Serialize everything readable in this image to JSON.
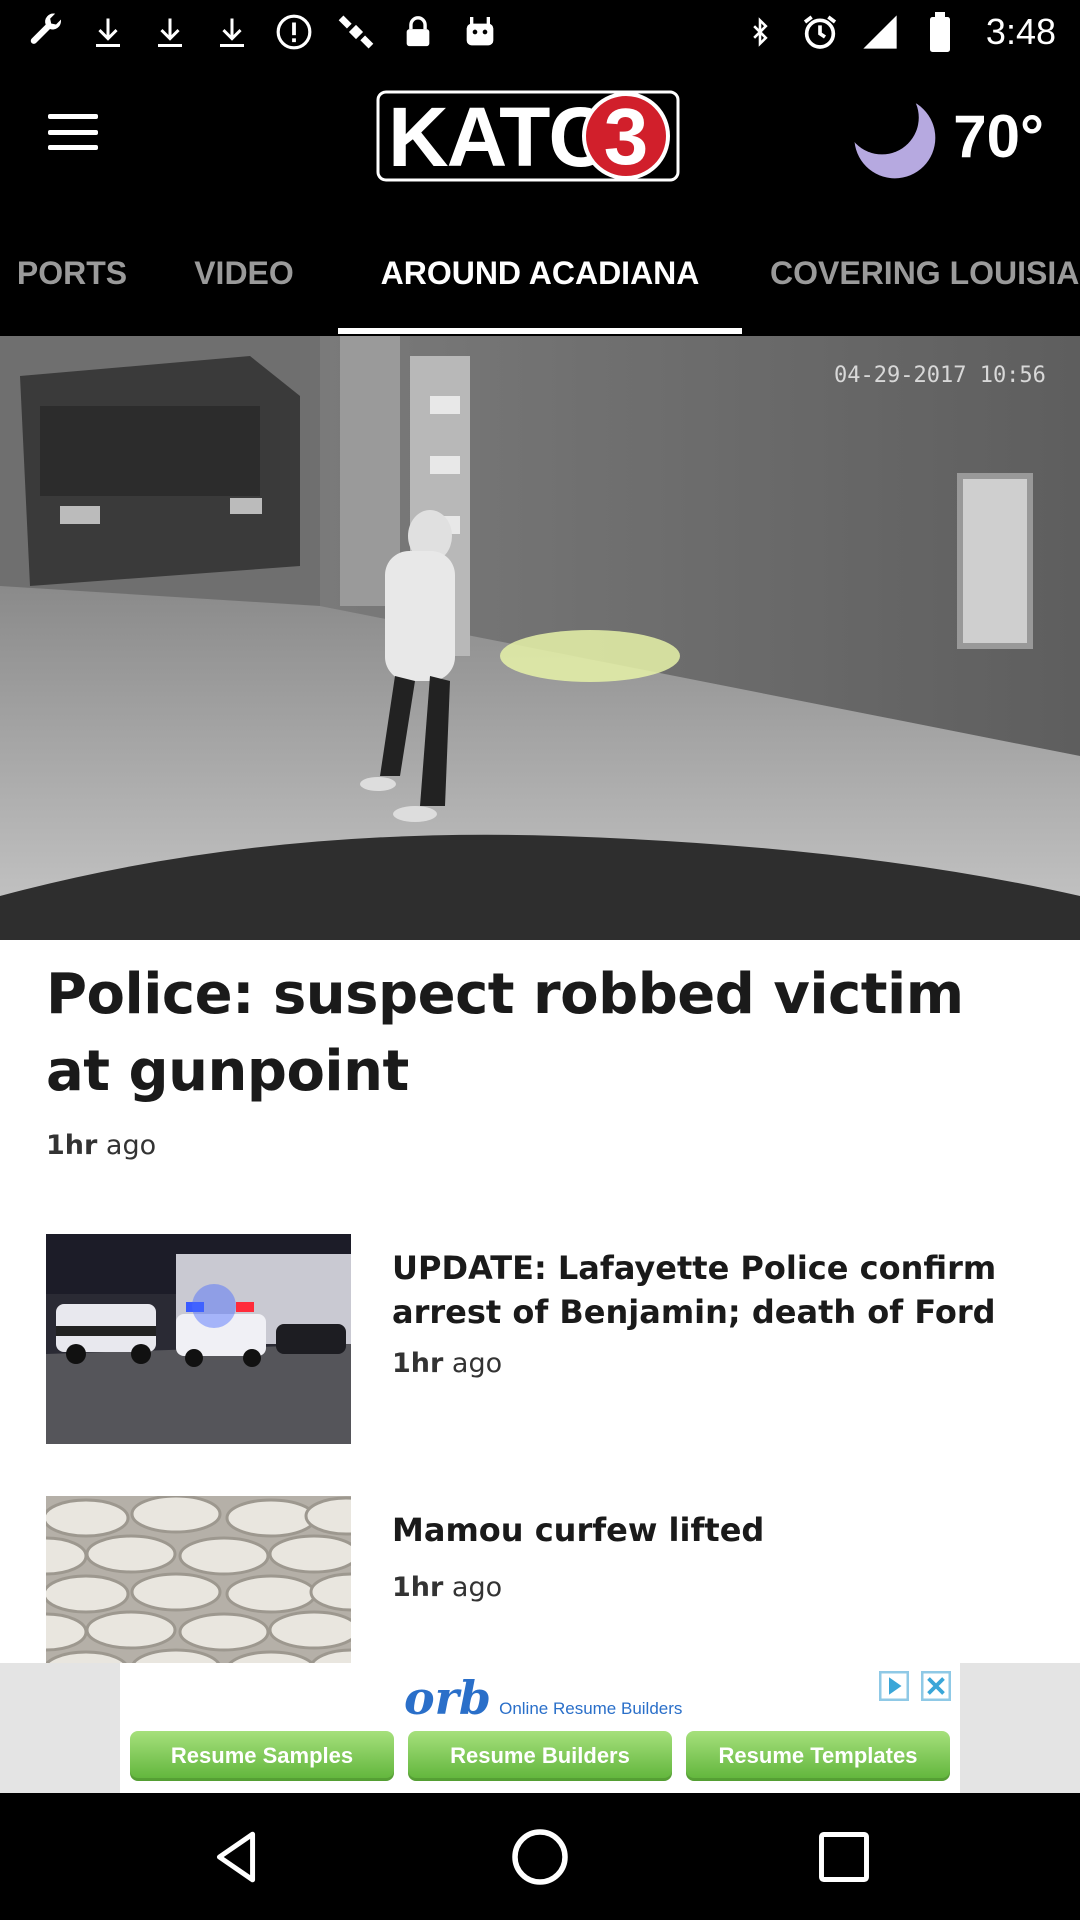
{
  "status_bar": {
    "time": "3:48",
    "left_icons": [
      "wrench-icon",
      "download-icon",
      "download-icon",
      "download-icon",
      "alert-icon",
      "satellite-icon",
      "lock-icon",
      "android-icon"
    ],
    "right_icons": [
      "bluetooth-icon",
      "alarm-icon",
      "signal-icon",
      "battery-icon"
    ]
  },
  "header": {
    "logo_text": "KATC",
    "logo_number": "3",
    "temperature": "70°",
    "weather_icon": "moon-icon"
  },
  "tabs": {
    "items": [
      {
        "label": "PORTS"
      },
      {
        "label": "VIDEO"
      },
      {
        "label": "AROUND ACADIANA"
      },
      {
        "label": "COVERING LOUISIA"
      }
    ],
    "active_index": 2
  },
  "hero": {
    "timestamp_overlay": "04-29-2017  10:56",
    "title": "Police: suspect robbed victim at gunpoint",
    "time_num": "1hr",
    "time_unit": "ago"
  },
  "stories": [
    {
      "title": "UPDATE: Lafayette Police confirm arrest of Benjamin; death of Ford",
      "time_num": "1hr",
      "time_unit": "ago"
    },
    {
      "title": "Mamou curfew lifted",
      "time_num": "1hr",
      "time_unit": "ago"
    }
  ],
  "ad": {
    "brand": "orb",
    "tagline": "Online Resume Builders",
    "buttons": [
      "Resume Samples",
      "Resume Builders",
      "Resume Templates"
    ]
  },
  "nav": {
    "icons": [
      "back-icon",
      "home-icon",
      "recents-icon"
    ]
  },
  "colors": {
    "header_bg": "#000000",
    "tab_inactive": "#9a9a9a",
    "moon": "#b6a9e0",
    "logo_red": "#d11f2b",
    "ad_blue": "#2a6fc9",
    "ad_green": "#5fb43a"
  }
}
